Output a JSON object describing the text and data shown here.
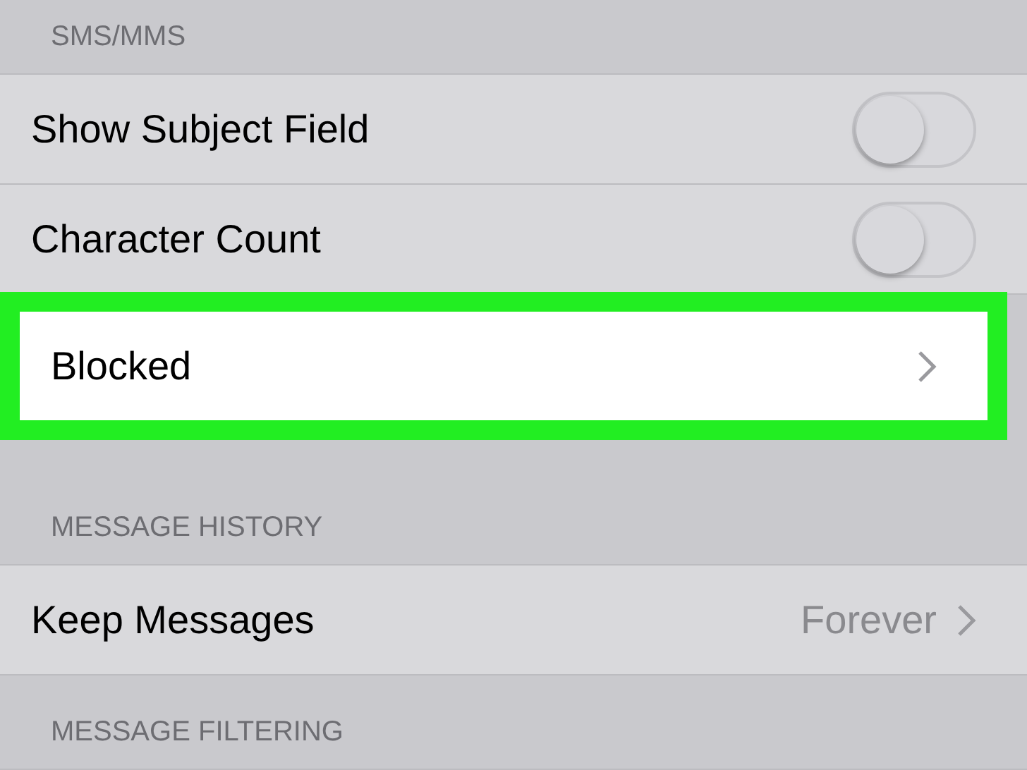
{
  "sections": [
    {
      "header": "SMS/MMS",
      "rows": [
        {
          "kind": "toggle",
          "label": "Show Subject Field",
          "on": false,
          "highlighted": false
        },
        {
          "kind": "toggle",
          "label": "Character Count",
          "on": false,
          "highlighted": false
        },
        {
          "kind": "link",
          "label": "Blocked",
          "highlighted": true
        }
      ]
    },
    {
      "header": "MESSAGE HISTORY",
      "rows": [
        {
          "kind": "link",
          "label": "Keep Messages",
          "value": "Forever",
          "highlighted": false
        }
      ]
    },
    {
      "header": "MESSAGE FILTERING"
    }
  ]
}
